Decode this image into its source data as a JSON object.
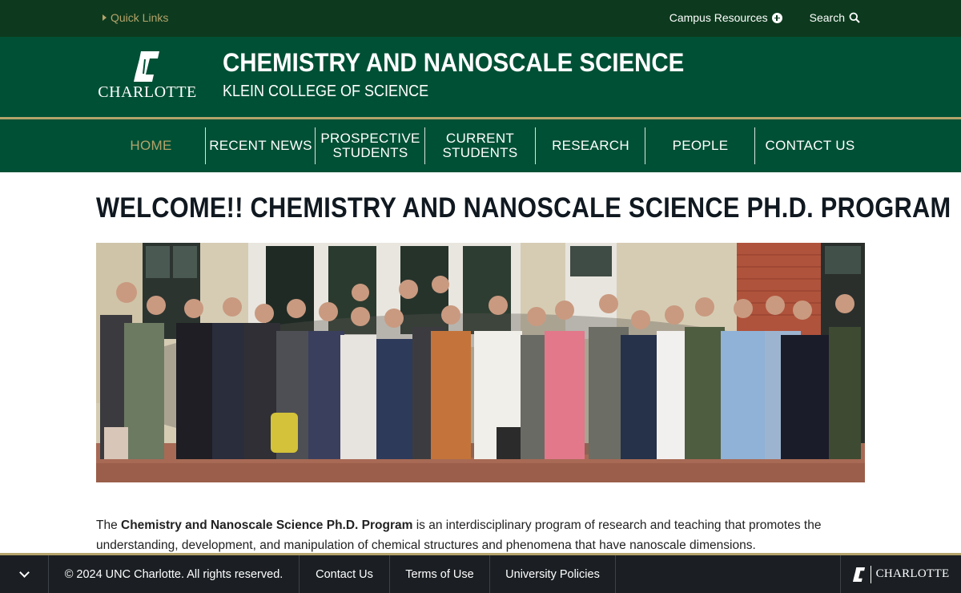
{
  "utility": {
    "quick_links": "Quick Links",
    "campus_resources": "Campus Resources",
    "search": "Search"
  },
  "header": {
    "logo_word": "CHARLOTTE",
    "title": "CHEMISTRY AND NANOSCALE SCIENCE",
    "subtitle": "KLEIN COLLEGE OF SCIENCE"
  },
  "nav": {
    "items": [
      {
        "label": "HOME",
        "active": true
      },
      {
        "label": "RECENT NEWS"
      },
      {
        "label": "PROSPECTIVE\nSTUDENTS"
      },
      {
        "label": "CURRENT\nSTUDENTS"
      },
      {
        "label": "RESEARCH"
      },
      {
        "label": "PEOPLE"
      },
      {
        "label": "CONTACT US"
      }
    ]
  },
  "main": {
    "title": "WELCOME!! CHEMISTRY AND NANOSCALE SCIENCE PH.D. PROGRAM",
    "intro_pre": "The ",
    "intro_bold": "Chemistry and Nanoscale Science Ph.D. Program",
    "intro_post": " is an interdisciplinary program of research and teaching that promotes the understanding, development, and manipulation of chemical structures and phenomena that have nanoscale dimensions."
  },
  "footer": {
    "copyright": "© 2024 UNC Charlotte. All rights reserved.",
    "contact": "Contact Us",
    "terms": "Terms of Use",
    "policies": "University Policies",
    "logo_word": "CHARLOTTE"
  },
  "colors": {
    "dark_green": "#0d3a1e",
    "green": "#005035",
    "gold": "#b4a36b",
    "footer_bg": "#1b1f23"
  }
}
